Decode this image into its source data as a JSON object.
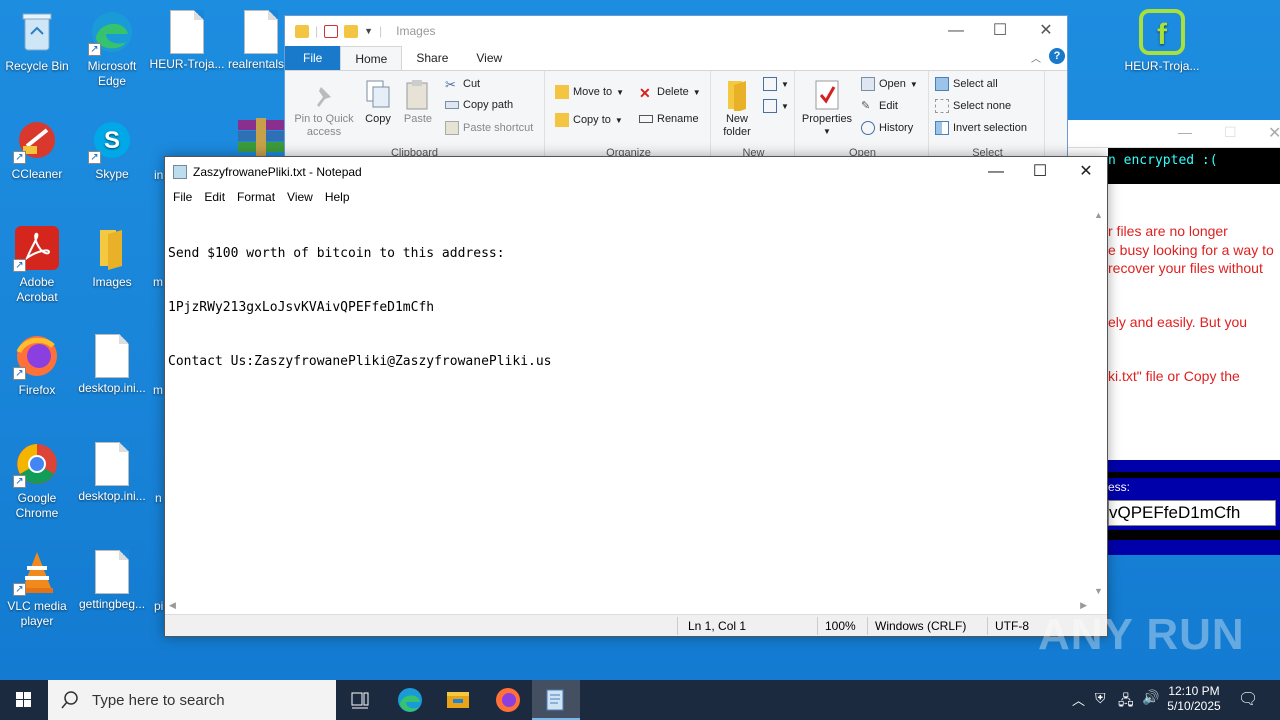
{
  "desktop": {
    "icons": [
      {
        "label": "Recycle Bin"
      },
      {
        "label": "Microsoft Edge"
      },
      {
        "label": "HEUR-Troja..."
      },
      {
        "label": "realrentals..."
      },
      {
        "label": "CCleaner"
      },
      {
        "label": "Skype"
      },
      {
        "label": "Adobe Acrobat"
      },
      {
        "label": "Images"
      },
      {
        "label": "Firefox"
      },
      {
        "label": "desktop.ini..."
      },
      {
        "label": "Google Chrome"
      },
      {
        "label": "desktop.ini..."
      },
      {
        "label": "VLC media player"
      },
      {
        "label": "gettingbeg..."
      },
      {
        "label": "HEUR-Troja..."
      }
    ],
    "partial_labels": [
      "in",
      "m",
      "m",
      "n",
      "pi"
    ]
  },
  "explorer": {
    "title": "Images",
    "tabs": [
      "File",
      "Home",
      "Share",
      "View"
    ],
    "active_tab": "Home",
    "clipboard": {
      "pin": "Pin to Quick access",
      "copy": "Copy",
      "paste": "Paste",
      "cut": "Cut",
      "copy_path": "Copy path",
      "paste_shortcut": "Paste shortcut",
      "label": "Clipboard"
    },
    "organize": {
      "move_to": "Move to",
      "copy_to": "Copy to",
      "delete": "Delete",
      "rename": "Rename",
      "label": "Organize"
    },
    "new": {
      "new_folder": "New folder",
      "label": "New"
    },
    "open": {
      "properties": "Properties",
      "open": "Open",
      "edit": "Edit",
      "history": "History",
      "label": "Open"
    },
    "select": {
      "select_all": "Select all",
      "select_none": "Select none",
      "invert": "Invert selection",
      "label": "Select"
    }
  },
  "ransom_window": {
    "header_text": "n encrypted :(",
    "lines": [
      "r files are no longer",
      "e busy looking for a way to",
      "recover your files without",
      "ely and easily. But you",
      "ki.txt\" file or Copy the",
      "ess:"
    ],
    "address_fragment": "vQPEFfeD1mCfh"
  },
  "notepad": {
    "title": "ZaszyfrowanePliki.txt - Notepad",
    "menu": [
      "File",
      "Edit",
      "Format",
      "View",
      "Help"
    ],
    "lines": [
      "Send $100 worth of bitcoin to this address:",
      "1PjzRWy213gxLoJsvKVAivQPEFfeD1mCfh",
      "Contact Us:ZaszyfrowanePliki@ZaszyfrowanePliki.us"
    ],
    "status": {
      "position": "Ln 1, Col 1",
      "zoom": "100%",
      "line_ending": "Windows (CRLF)",
      "encoding": "UTF-8"
    }
  },
  "watermark": "ANY RUN",
  "taskbar": {
    "search_placeholder": "Type here to search",
    "time": "12:10 PM",
    "date": "5/10/2025"
  },
  "colors": {
    "desktop_bg": "#1a86da",
    "taskbar_bg": "#1b2a3f",
    "ribbon_file_tab": "#1979ca",
    "ransom_text": "#e02020"
  }
}
